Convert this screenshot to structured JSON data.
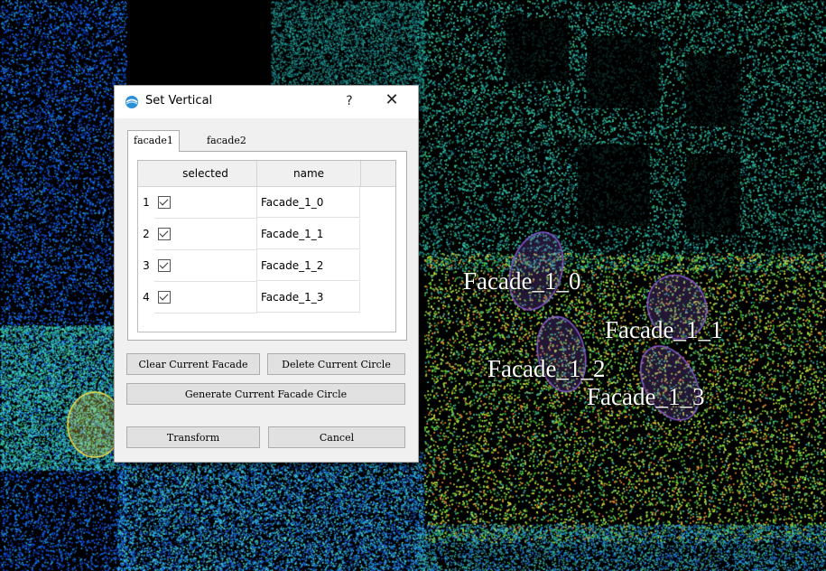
{
  "dialog": {
    "title": "Set Vertical",
    "help_label": "?",
    "close_label": "✕",
    "tabs": [
      {
        "label": "facade1",
        "active": true
      },
      {
        "label": "facade2",
        "active": false
      }
    ],
    "table": {
      "columns": [
        "selected",
        "name"
      ],
      "rows": [
        {
          "index": "1",
          "selected": true,
          "name": "Facade_1_0"
        },
        {
          "index": "2",
          "selected": true,
          "name": "Facade_1_1"
        },
        {
          "index": "3",
          "selected": true,
          "name": "Facade_1_2"
        },
        {
          "index": "4",
          "selected": true,
          "name": "Facade_1_3"
        }
      ]
    },
    "buttons": {
      "clear": "Clear Current Facade",
      "delete": "Delete Current Circle",
      "generate": "Generate Current Facade Circle",
      "transform": "Transform",
      "cancel": "Cancel"
    }
  },
  "scene": {
    "labels": [
      "Facade_1_0",
      "Facade_1_1",
      "Facade_1_2",
      "Facade_1_3"
    ],
    "circle_colors": {
      "facade": "#8a5ad0",
      "ground": "#f4e04a"
    }
  }
}
